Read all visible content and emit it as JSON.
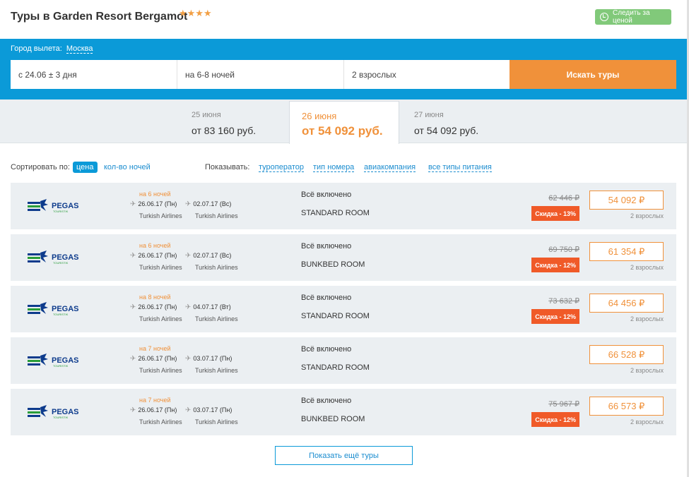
{
  "header": {
    "title": "Туры в Garden Resort Bergamot",
    "stars": "★★★★",
    "watch_label": "Следить за ценой"
  },
  "search": {
    "city_label": "Город вылета:",
    "city": "Москва",
    "date_field": "с 24.06 ± 3 дня",
    "nights_field": "на 6-8 ночей",
    "guests_field": "2 взрослых",
    "submit_label": "Искать туры"
  },
  "dates": [
    {
      "date": "25 июня",
      "price": "от 83 160 руб."
    },
    {
      "date": "26 июня",
      "price": "от 54 092 руб.",
      "active": true
    },
    {
      "date": "27 июня",
      "price": "от 54 092 руб."
    }
  ],
  "sort": {
    "label": "Сортировать по:",
    "by_price": "цена",
    "by_nights": "кол-во ночей",
    "show_label": "Показывать:",
    "filters": [
      "туроператор",
      "тип номера",
      "авиакомпания",
      "все типы питания"
    ]
  },
  "tours": [
    {
      "operator": "PEGAS",
      "operator_sub": "TOURISTIK",
      "nights": "на 6 ночей",
      "out_date": "26.06.17 (Пн)",
      "back_date": "02.07.17 (Вс)",
      "out_airline": "Turkish Airlines",
      "back_airline": "Turkish Airlines",
      "meal": "Всё включено",
      "room": "STANDARD ROOM",
      "old_price": "62 446 ₽",
      "discount": "Скидка - 13%",
      "price": "54 092 ₽",
      "pax": "2 взрослых"
    },
    {
      "operator": "PEGAS",
      "operator_sub": "TOURISTIK",
      "nights": "на 6 ночей",
      "out_date": "26.06.17 (Пн)",
      "back_date": "02.07.17 (Вс)",
      "out_airline": "Turkish Airlines",
      "back_airline": "Turkish Airlines",
      "meal": "Всё включено",
      "room": "BUNKBED ROOM",
      "old_price": "69 750 ₽",
      "discount": "Скидка - 12%",
      "price": "61 354 ₽",
      "pax": "2 взрослых"
    },
    {
      "operator": "PEGAS",
      "operator_sub": "TOURISTIK",
      "nights": "на 8 ночей",
      "out_date": "26.06.17 (Пн)",
      "back_date": "04.07.17 (Вт)",
      "out_airline": "Turkish Airlines",
      "back_airline": "Turkish Airlines",
      "meal": "Всё включено",
      "room": "STANDARD ROOM",
      "old_price": "73 632 ₽",
      "discount": "Скидка - 12%",
      "price": "64 456 ₽",
      "pax": "2 взрослых"
    },
    {
      "operator": "PEGAS",
      "operator_sub": "TOURISTIK",
      "nights": "на 7 ночей",
      "out_date": "26.06.17 (Пн)",
      "back_date": "03.07.17 (Пн)",
      "out_airline": "Turkish Airlines",
      "back_airline": "Turkish Airlines",
      "meal": "Всё включено",
      "room": "STANDARD ROOM",
      "old_price": "",
      "discount": "",
      "price": "66 528 ₽",
      "pax": "2 взрослых"
    },
    {
      "operator": "PEGAS",
      "operator_sub": "TOURISTIK",
      "nights": "на 7 ночей",
      "out_date": "26.06.17 (Пн)",
      "back_date": "03.07.17 (Пн)",
      "out_airline": "Turkish Airlines",
      "back_airline": "Turkish Airlines",
      "meal": "Всё включено",
      "room": "BUNKBED ROOM",
      "old_price": "75 967 ₽",
      "discount": "Скидка - 12%",
      "price": "66 573 ₽",
      "pax": "2 взрослых"
    }
  ],
  "more_label": "Показать ещё туры",
  "colors": {
    "accent_blue": "#0b9ad8",
    "accent_orange": "#f0913a",
    "discount_red": "#f05a28",
    "watch_green": "#81c97a",
    "row_bg": "#ebeff2"
  }
}
